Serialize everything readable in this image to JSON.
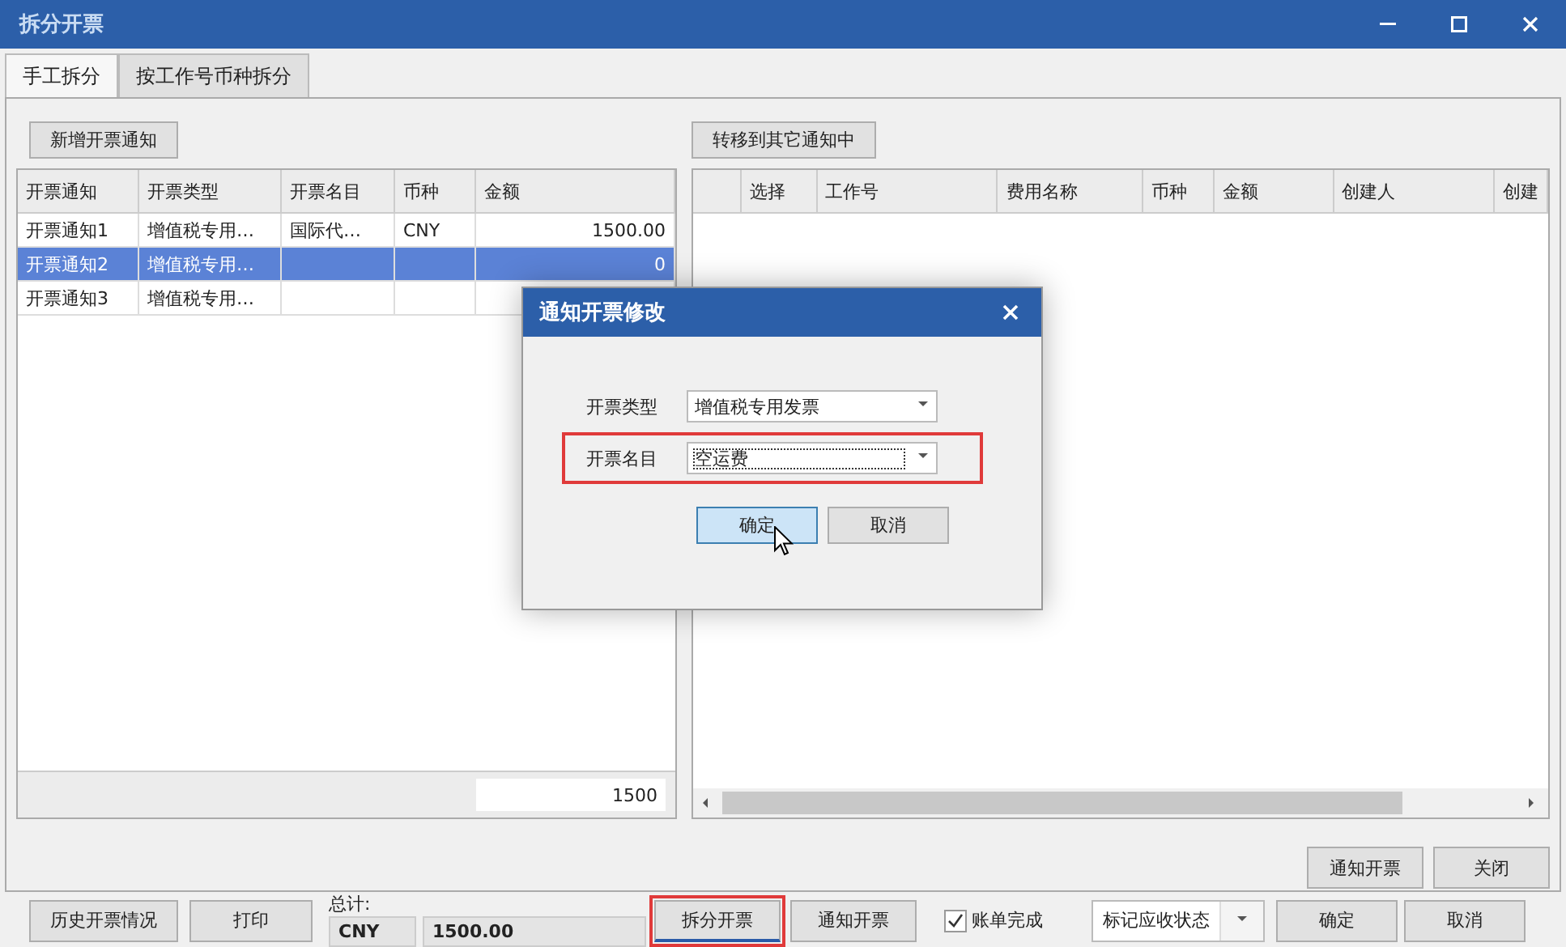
{
  "window": {
    "title": "拆分开票"
  },
  "tabs": [
    {
      "label": "手工拆分",
      "selected": true
    },
    {
      "label": "按工作号币种拆分",
      "selected": false
    }
  ],
  "left": {
    "add_button": "新增开票通知",
    "table": {
      "columns": [
        "开票通知",
        "开票类型",
        "开票名目",
        "币种",
        "金额"
      ],
      "rows": [
        {
          "selected": false,
          "cells": [
            "开票通知1",
            "增值税专用…",
            "国际代…",
            "CNY",
            "1500.00"
          ]
        },
        {
          "selected": true,
          "cells": [
            "开票通知2",
            "增值税专用…",
            "",
            "",
            "0"
          ]
        },
        {
          "selected": false,
          "cells": [
            "开票通知3",
            "增值税专用…",
            "",
            "",
            ""
          ]
        }
      ],
      "footer_total": "1500"
    }
  },
  "right": {
    "transfer_button": "转移到其它通知中",
    "table": {
      "columns": [
        "",
        "选择",
        "工作号",
        "费用名称",
        "币种",
        "金额",
        "创建人",
        "创建"
      ]
    },
    "actions": [
      "通知开票",
      "关闭"
    ]
  },
  "bottom_bar": {
    "left_buttons": [
      "历史开票情况",
      "打印"
    ],
    "total_label": "总计:",
    "totals": [
      {
        "currency": "CNY",
        "amount": "1500.00"
      }
    ],
    "middle_buttons": [
      {
        "label": "拆分开票",
        "highlighted": true
      },
      {
        "label": "通知开票",
        "highlighted": false
      }
    ],
    "checkbox": {
      "label": "账单完成",
      "checked": true
    },
    "status_dropdown": {
      "value": "标记应收状态"
    },
    "right_buttons": [
      "确定",
      "取消"
    ]
  },
  "dialog": {
    "title": "通知开票修改",
    "fields": [
      {
        "label": "开票类型",
        "value": "增值税专用发票",
        "highlighted": false
      },
      {
        "label": "开票名目",
        "value": "空运费",
        "highlighted": true
      }
    ],
    "buttons": [
      {
        "label": "确定",
        "focused": true
      },
      {
        "label": "取消",
        "focused": false
      }
    ]
  }
}
